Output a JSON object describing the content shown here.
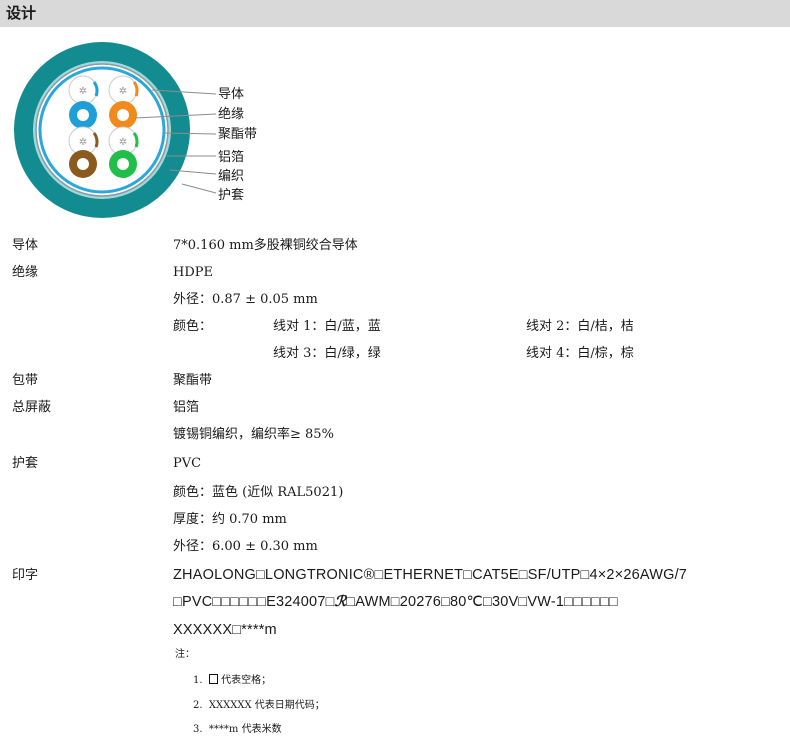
{
  "header": {
    "title": "设计"
  },
  "diagram": {
    "callouts": [
      "导体",
      "绝缘",
      "聚酯带",
      "铝箔",
      "编织",
      "护套"
    ],
    "colors": {
      "jacket": "#138c91",
      "blue": "#1ea0d6",
      "orange": "#f08a1d",
      "green": "#1fbf4a",
      "brown": "#8a5a1f"
    }
  },
  "rows": {
    "conductor": {
      "label": "导体",
      "value": "7*0.160 mm多股裸铜绞合导体"
    },
    "insulation": {
      "label": "绝缘",
      "material": "HDPE",
      "od": "外径：0.87 ± 0.05 mm",
      "color_label": "颜色：",
      "pair1": "线对 1：白/蓝，蓝",
      "pair2": "线对 2：白/桔，桔",
      "pair3": "线对 3：白/绿，绿",
      "pair4": "线对 4：白/棕，棕"
    },
    "wrap": {
      "label": "包带",
      "value": "聚酯带"
    },
    "shield": {
      "label": "总屏蔽",
      "foil": "铝箔",
      "braid": "镀锡铜编织，编织率≥ 85%"
    },
    "jacket": {
      "label": "护套",
      "material": "PVC",
      "color": "颜色：蓝色 (近似 RAL5021)",
      "thickness": "厚度：约 0.70 mm",
      "od": "外径：6.00 ± 0.30 mm"
    },
    "marking": {
      "label": "印字",
      "line1": "ZHAOLONG□LONGTRONIC®□ETHERNET□CAT5E□SF/UTP□4×2×26AWG/7",
      "line2a": "□PVC□□□□□□E324007□",
      "line2_logo": "ℛ",
      "line2b": "□AWM□20276□80℃□30V□VW-1□□□□□□",
      "line3": "XXXXXX□****m"
    }
  },
  "notes": {
    "title": "注：",
    "items": [
      "1.",
      "代表空格；",
      "2.",
      "XXXXXX 代表日期代码；",
      "3.",
      "****m 代表米数"
    ]
  }
}
